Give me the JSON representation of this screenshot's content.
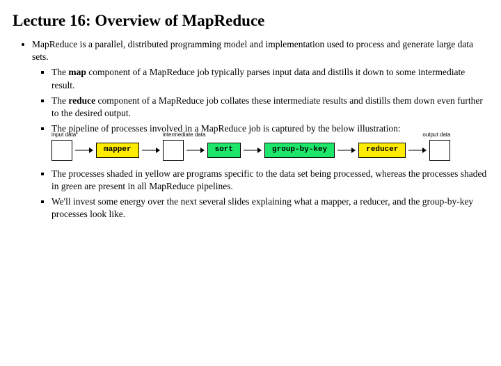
{
  "title": "Lecture 16: Overview of MapReduce",
  "bullets": {
    "intro": "MapReduce is a parallel, distributed programming model and implementation used to process and generate large data sets.",
    "map_pre": "The ",
    "map_bold": "map",
    "map_post": " component of a MapReduce job typically parses input data and distills it down to some intermediate result.",
    "reduce_pre": "The ",
    "reduce_bold": "reduce",
    "reduce_post": " component of a MapReduce job collates these intermediate results and distills them down even further to the desired output.",
    "pipeline": "The pipeline of processes involved in a MapReduce job is captured by the below illustration:",
    "shading": "The processes shaded in yellow are programs specific to the data set being processed, whereas the processes shaded in green are present in all MapReduce pipelines.",
    "invest": "We'll invest some energy over the next several slides explaining what a mapper, a reducer, and the group-by-key processes look like."
  },
  "diagram": {
    "input_label": "input data",
    "intermediate_label": "intermediate data",
    "output_label": "output data",
    "mapper": "mapper",
    "sort": "sort",
    "group": "group-by-key",
    "reducer": "reducer"
  }
}
